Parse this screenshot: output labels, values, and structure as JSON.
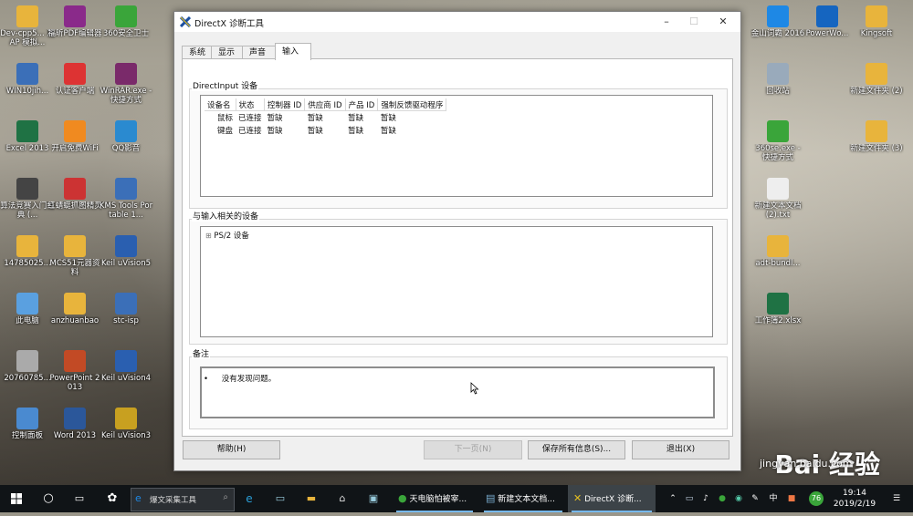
{
  "window": {
    "title": "DirectX 诊断工具"
  },
  "tabs": [
    "系统",
    "显示",
    "声音",
    "输入"
  ],
  "directinput": {
    "title": "DirectInput 设备",
    "headers": [
      "设备名",
      "状态",
      "控制器 ID",
      "供应商 ID",
      "产品 ID",
      "强制反馈驱动程序"
    ],
    "rows": [
      [
        "鼠标",
        "已连接",
        "暂缺",
        "暂缺",
        "暂缺",
        "暂缺"
      ],
      [
        "键盘",
        "已连接",
        "暂缺",
        "暂缺",
        "暂缺",
        "暂缺"
      ]
    ]
  },
  "related": {
    "title": "与输入相关的设备",
    "tree_expander": "⊞",
    "item": "PS/2 设备"
  },
  "notes": {
    "title": "备注",
    "text": "没有发现问题。"
  },
  "buttons": {
    "help": "帮助(H)",
    "next": "下一页(N)",
    "save": "保存所有信息(S)...",
    "exit": "退出(X)"
  },
  "desktop_icons_left": [
    {
      "label": "Dev-cpp5... 及AP 模拟...",
      "color": "#e8b43c"
    },
    {
      "label": "WIN10jih...",
      "color": "#3b6fb8"
    },
    {
      "label": "Excel 2013",
      "color": "#1f7244"
    },
    {
      "label": "算法竞赛入门经典 (...",
      "color": "#444"
    },
    {
      "label": "14785025...",
      "color": "#e8b43c"
    },
    {
      "label": "此电脑",
      "color": "#5aa0e0"
    },
    {
      "label": "20760785...",
      "color": "#aaa"
    },
    {
      "label": "控制面板",
      "color": "#4a8ad0"
    }
  ],
  "desktop_icons_col2": [
    {
      "label": "福昕PDF编辑器",
      "color": "#8a2a8a"
    },
    {
      "label": "认证客户端",
      "color": "#d33"
    },
    {
      "label": "开启免费WiFi",
      "color": "#f08a20"
    },
    {
      "label": "红蜻蜓抓图精灵",
      "color": "#c33"
    },
    {
      "label": "MCS51元器资料",
      "color": "#e8b43c"
    },
    {
      "label": "anzhuanbao",
      "color": "#e8b43c"
    },
    {
      "label": "PowerPoint 2013",
      "color": "#c24a25"
    },
    {
      "label": "Word 2013",
      "color": "#2b579a"
    }
  ],
  "desktop_icons_col3": [
    {
      "label": "360安全卫士",
      "color": "#3aa53a"
    },
    {
      "label": "WinRAR.exe - 快捷方式",
      "color": "#7a2a6a"
    },
    {
      "label": "QQ影音",
      "color": "#2a8ad0"
    },
    {
      "label": "KMS Tools Portable 1...",
      "color": "#3b6fb8"
    },
    {
      "label": "Keil uVision5",
      "color": "#2a5fb0"
    },
    {
      "label": "stc-isp",
      "color": "#3b6fb8"
    },
    {
      "label": "Keil uVision4",
      "color": "#2a5fb0"
    },
    {
      "label": "Keil uVision3",
      "color": "#c8a020"
    }
  ],
  "desktop_icons_right1": [
    {
      "label": "金山词霸 2016",
      "color": "#1e88e5"
    },
    {
      "label": "回收站",
      "color": "#9ab"
    },
    {
      "label": "360se.exe - 快捷方式",
      "color": "#3aa53a"
    },
    {
      "label": "新建文本文档 (2).txt",
      "color": "#eee"
    },
    {
      "label": "adt-bundl...",
      "color": "#e8b43c"
    },
    {
      "label": "工作簿2.xlsx",
      "color": "#1f7244"
    }
  ],
  "desktop_icons_right2": [
    {
      "label": "PowerWo...",
      "color": "#1565c0"
    },
    {
      "label": "Kingsoft",
      "color": "#e8b43c"
    },
    {
      "label": "新建文件夹 (2)",
      "color": "#e8b43c"
    },
    {
      "label": "新建文件夹 (3)",
      "color": "#e8b43c"
    }
  ],
  "taskbar": {
    "search": "爆文采集工具",
    "apps": [
      "天电脑怕被宰...",
      "新建文本文档...",
      "DirectX 诊断..."
    ],
    "time": "19:14",
    "date": "2019/2/19",
    "ime": "中",
    "badge": "76"
  },
  "watermark": {
    "brand": "Bai 经验",
    "url": "jingyan.baidu.com"
  }
}
